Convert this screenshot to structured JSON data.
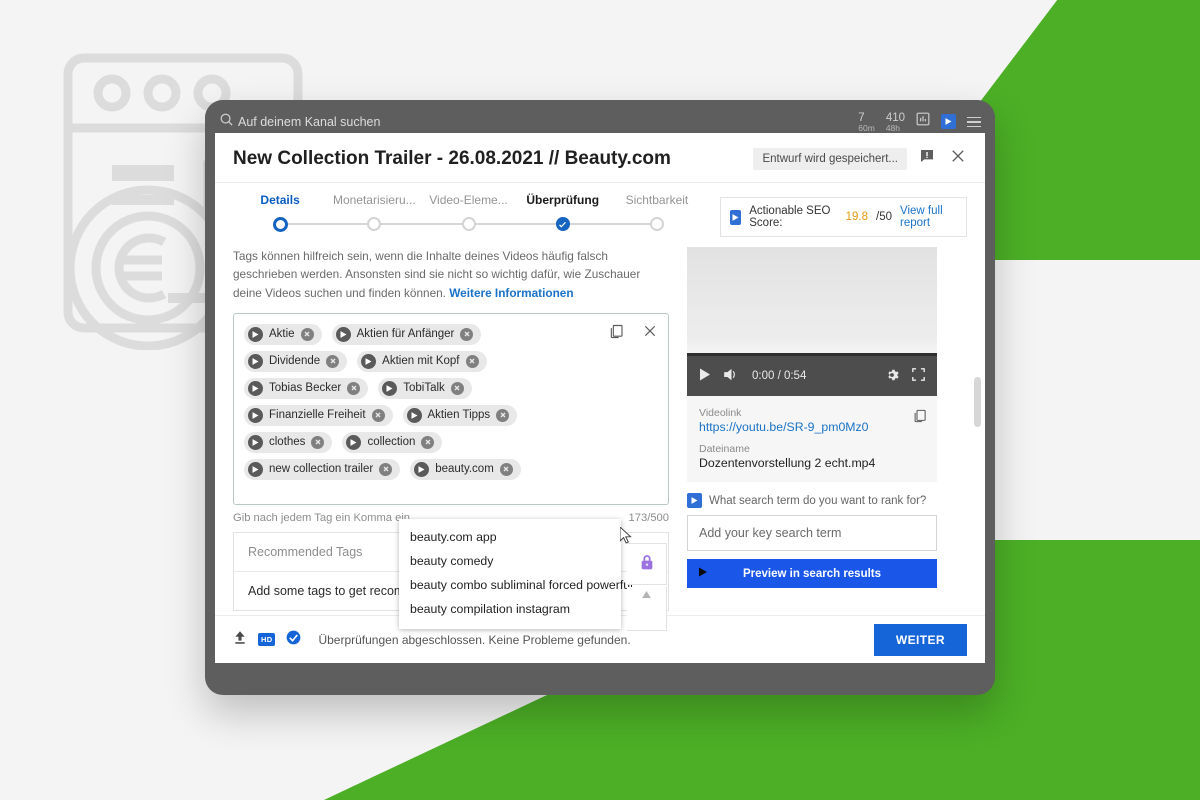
{
  "theme": {
    "accent_green": "#4caf26",
    "accent_blue": "#1565d8",
    "score_orange": "#e8960f",
    "link_blue": "#1a73c8"
  },
  "browser": {
    "search_placeholder": "Auf deinem Kanal suchen",
    "stats": [
      {
        "value": "7",
        "unit": "60m"
      },
      {
        "value": "410",
        "unit": "48h"
      }
    ],
    "icons": [
      "search-icon",
      "analytics-icon",
      "tubebuddy-icon",
      "menu-icon"
    ]
  },
  "dialog": {
    "title": "New Collection Trailer - 26.08.2021 // Beauty.com",
    "save_status": "Entwurf wird gespeichert...",
    "feedback_icon": "feedback-icon",
    "close_icon": "close-icon"
  },
  "stepper": {
    "steps": [
      {
        "label": "Details",
        "state": "active"
      },
      {
        "label": "Monetarisieru...",
        "state": "upcoming"
      },
      {
        "label": "Video-Eleme...",
        "state": "upcoming"
      },
      {
        "label": "Überprüfung",
        "state": "current"
      },
      {
        "label": "Sichtbarkeit",
        "state": "upcoming"
      }
    ]
  },
  "seo": {
    "icon": "tubebuddy-icon",
    "label": "Actionable SEO Score:",
    "score": "19.8",
    "max": "/50",
    "report_link": "View full report"
  },
  "tags_help": {
    "line1": "Tags können hilfreich sein, wenn die Inhalte deines Videos häufig falsch geschrieben werden.",
    "line2": "Ansonsten sind sie nicht so wichtig dafür, wie Zuschauer deine Videos suchen und finden",
    "line3": "können.",
    "link": "Weitere Informationen"
  },
  "tags": {
    "rows": [
      [
        "Aktie",
        "Aktien für Anfänger"
      ],
      [
        "Dividende",
        "Aktien mit Kopf"
      ],
      [
        "Tobias Becker",
        "TobiTalk"
      ],
      [
        "Finanzielle Freiheit",
        "Aktien Tipps"
      ],
      [
        "clothes",
        "collection"
      ],
      [
        "new collection trailer",
        "beauty.com"
      ]
    ],
    "copy_icon": "copy-icon",
    "clear_icon": "clear-icon",
    "hint": "Gib nach jedem Tag ein Komma ein",
    "char_count": "173/500",
    "lock_icon": "lock-icon"
  },
  "autocomplete": {
    "items": [
      "beauty.com app",
      "beauty comedy",
      "beauty combo subliminal forced powerful",
      "beauty compilation instagram"
    ]
  },
  "recommended": {
    "header": "Recommended Tags",
    "body": "Add some tags to get recomm"
  },
  "player": {
    "play_icon": "play-icon",
    "volume_icon": "volume-icon",
    "time": "0:00 / 0:54",
    "settings_icon": "gear-icon",
    "fullscreen_icon": "fullscreen-icon"
  },
  "meta": {
    "videolink_label": "Videolink",
    "videolink_value": "https://youtu.be/SR-9_pm0Mz0",
    "filename_label": "Dateiname",
    "filename_value": "Dozentenvorstellung 2 echt.mp4",
    "copy_icon": "copy-icon"
  },
  "rank": {
    "icon": "tubebuddy-icon",
    "question": "What search term do you want to rank for?",
    "input_placeholder": "Add your key search term",
    "preview_button": "Preview in search results"
  },
  "footer": {
    "upload_icon": "upload-icon",
    "hd_badge": "HD",
    "check_icon": "check-circle-icon",
    "message": "Überprüfungen abgeschlossen. Keine Probleme gefunden.",
    "next_button": "WEITER"
  }
}
